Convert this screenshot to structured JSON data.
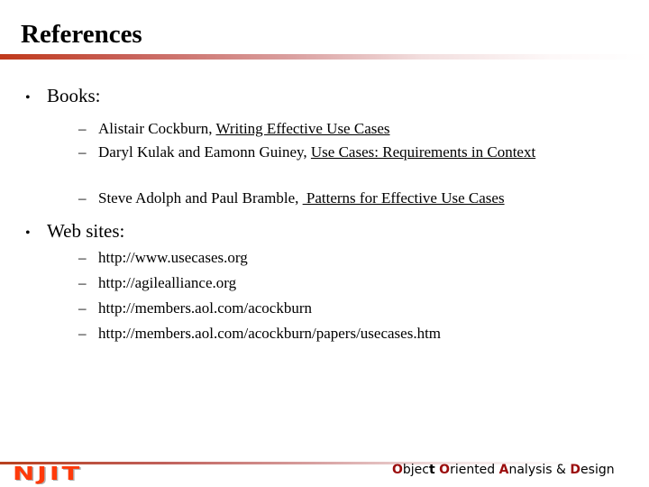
{
  "slide": {
    "title": "References",
    "sections": [
      {
        "heading": "Books:",
        "items": [
          {
            "prefix": "Alistair Cockburn, ",
            "title": "Writing Effective Use Cases"
          },
          {
            "prefix": "Daryl Kulak and Eamonn Guiney, ",
            "title": "Use Cases: Requirements in Context"
          },
          {
            "prefix": "Steve Adolph and Paul Bramble, ",
            "title": " Patterns for Effective Use Cases"
          }
        ]
      },
      {
        "heading": "Web sites:",
        "items": [
          {
            "text": "http://www.usecases.org"
          },
          {
            "text": "http://agilealliance.org"
          },
          {
            "text": "http://members.aol.com/acockburn"
          },
          {
            "text": "http://members.aol.com/acockburn/papers/usecases.htm"
          }
        ]
      }
    ],
    "bullet_glyph": "•",
    "dash_glyph": "–"
  },
  "footer": {
    "logo_text": "NJIT",
    "course": {
      "w1_hl": "O",
      "w1_a": "bjec",
      "w1_b": "t",
      "w1_rest": " ",
      "w2_hl": "O",
      "w2_rest": "riented ",
      "w3_hl": "A",
      "w3_rest": "nalysis & ",
      "w4_hl": "D",
      "w4_rest": "esign"
    }
  },
  "colors": {
    "accent_red": "#c0391b",
    "logo_red": "#ff3a0a",
    "course_highlight": "#9b0d0d"
  }
}
